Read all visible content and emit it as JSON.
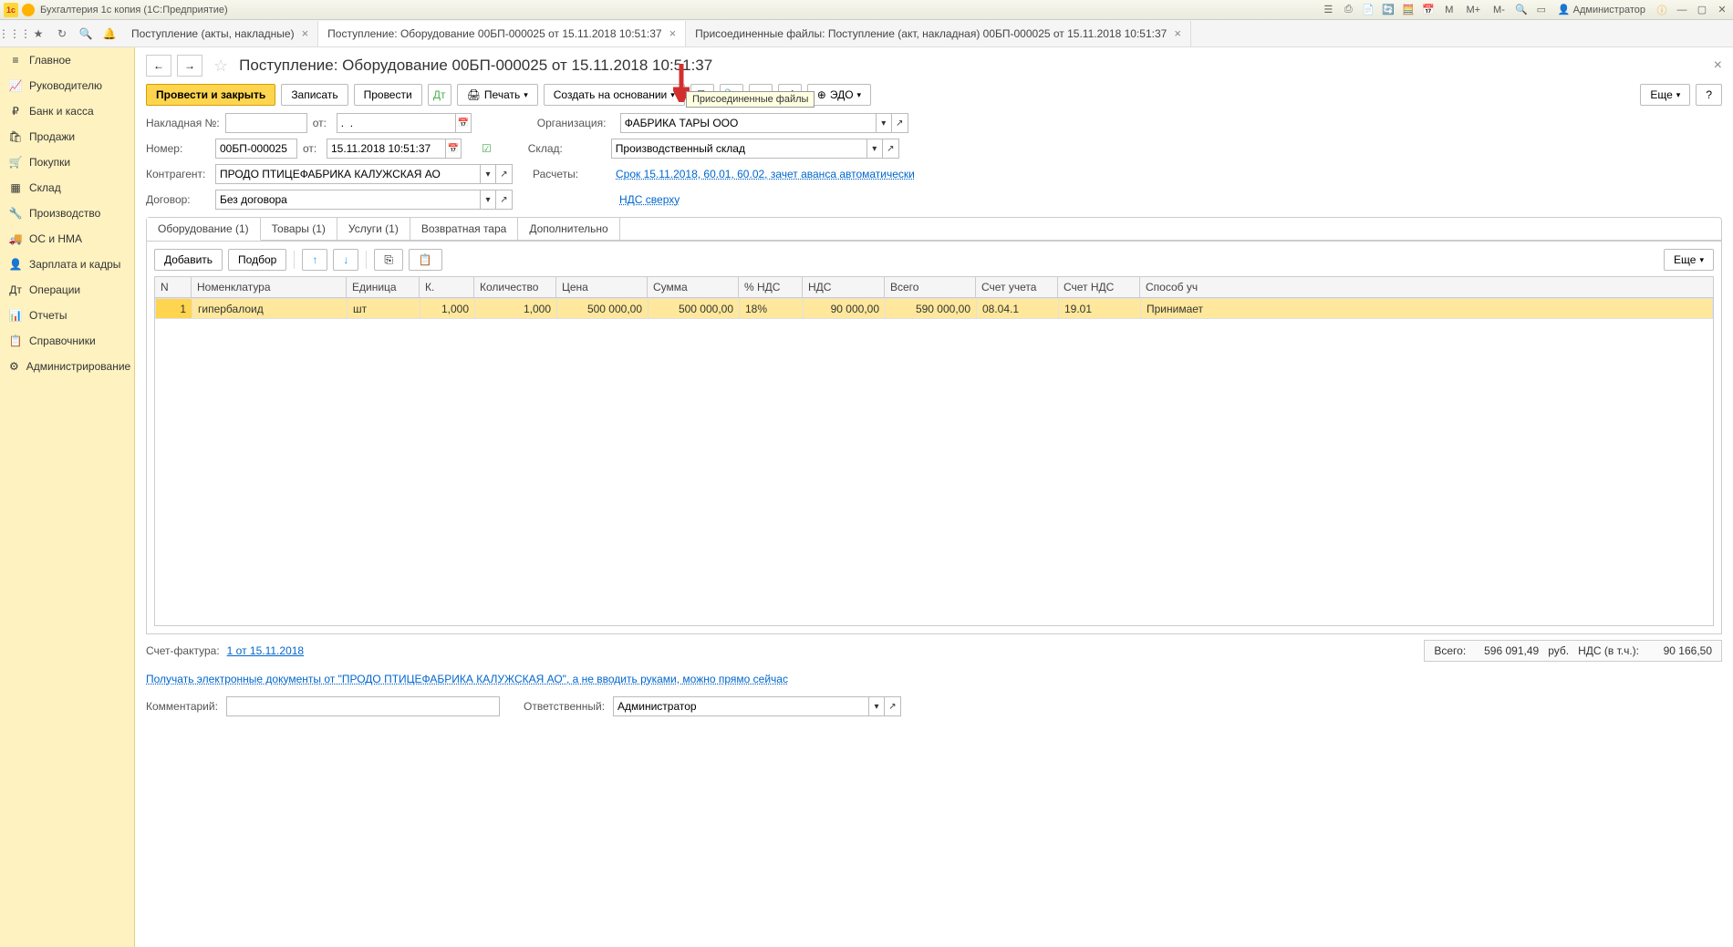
{
  "titlebar": {
    "title": "Бухгалтерия 1с копия  (1С:Предприятие)",
    "user_label": "Администратор",
    "m_label": "M",
    "m_plus": "M+",
    "m_minus": "M-"
  },
  "toolbar_tabs": [
    {
      "label": "Поступление (акты, накладные)",
      "active": false
    },
    {
      "label": "Поступление: Оборудование 00БП-000025 от 15.11.2018 10:51:37",
      "active": true
    },
    {
      "label": "Присоединенные файлы: Поступление (акт, накладная) 00БП-000025 от 15.11.2018 10:51:37",
      "active": false
    }
  ],
  "sidebar": {
    "items": [
      {
        "icon": "≡",
        "label": "Главное"
      },
      {
        "icon": "📈",
        "label": "Руководителю"
      },
      {
        "icon": "₽",
        "label": "Банк и касса"
      },
      {
        "icon": "🛍",
        "label": "Продажи"
      },
      {
        "icon": "🛒",
        "label": "Покупки"
      },
      {
        "icon": "▦",
        "label": "Склад"
      },
      {
        "icon": "🔧",
        "label": "Производство"
      },
      {
        "icon": "🚚",
        "label": "ОС и НМА"
      },
      {
        "icon": "👤",
        "label": "Зарплата и кадры"
      },
      {
        "icon": "Дт",
        "label": "Операции"
      },
      {
        "icon": "📊",
        "label": "Отчеты"
      },
      {
        "icon": "📋",
        "label": "Справочники"
      },
      {
        "icon": "⚙",
        "label": "Администрирование"
      }
    ]
  },
  "page": {
    "title": "Поступление: Оборудование 00БП-000025 от 15.11.2018 10:51:37",
    "tooltip": "Присоединенные файлы"
  },
  "actions": {
    "post_close": "Провести и закрыть",
    "save": "Записать",
    "post": "Провести",
    "print": "Печать",
    "create_based": "Создать на основании",
    "edo": "ЭДО",
    "more": "Еще",
    "help": "?"
  },
  "fields": {
    "invoice_no_label": "Накладная  №:",
    "invoice_no": "",
    "from_label": "от:",
    "invoice_date": ".  .",
    "number_label": "Номер:",
    "number": "00БП-000025",
    "date_label": "от:",
    "date": "15.11.2018 10:51:37",
    "org_label": "Организация:",
    "org": "ФАБРИКА ТАРЫ ООО",
    "warehouse_label": "Склад:",
    "warehouse": "Производственный склад",
    "counterparty_label": "Контрагент:",
    "counterparty": "ПРОДО ПТИЦЕФАБРИКА КАЛУЖСКАЯ АО",
    "contract_label": "Договор:",
    "contract": "Без договора",
    "calc_label": "Расчеты:",
    "calc_link": "Срок 15.11.2018, 60.01, 60.02, зачет аванса автоматически",
    "vat_link": "НДС сверху"
  },
  "subtabs": [
    {
      "label": "Оборудование (1)",
      "active": true
    },
    {
      "label": "Товары (1)",
      "active": false
    },
    {
      "label": "Услуги (1)",
      "active": false
    },
    {
      "label": "Возвратная тара",
      "active": false
    },
    {
      "label": "Дополнительно",
      "active": false
    }
  ],
  "table_toolbar": {
    "add": "Добавить",
    "select": "Подбор",
    "more": "Еще"
  },
  "table": {
    "headers": [
      "N",
      "Номенклатура",
      "Единица",
      "К.",
      "Количество",
      "Цена",
      "Сумма",
      "% НДС",
      "НДС",
      "Всего",
      "Счет учета",
      "Счет НДС",
      "Способ уч"
    ],
    "rows": [
      {
        "n": "1",
        "nom": "гипербалоид",
        "unit": "шт",
        "k": "1,000",
        "qty": "1,000",
        "price": "500 000,00",
        "sum": "500 000,00",
        "vat_pct": "18%",
        "vat": "90 000,00",
        "total": "590 000,00",
        "acc": "08.04.1",
        "acc_vat": "19.01",
        "method": "Принимает"
      }
    ]
  },
  "footer": {
    "invoice_label": "Счет-фактура:",
    "invoice_link": "1 от 15.11.2018",
    "edoc_link": "Получать электронные документы от \"ПРОДО ПТИЦЕФАБРИКА КАЛУЖСКАЯ АО\", а не вводить руками, можно прямо сейчас",
    "comment_label": "Комментарий:",
    "comment": "",
    "responsible_label": "Ответственный:",
    "responsible": "Администратор",
    "totals_total_label": "Всего:",
    "totals_total": "596 091,49",
    "totals_currency": "руб.",
    "totals_vat_label": "НДС (в т.ч.):",
    "totals_vat": "90 166,50"
  }
}
